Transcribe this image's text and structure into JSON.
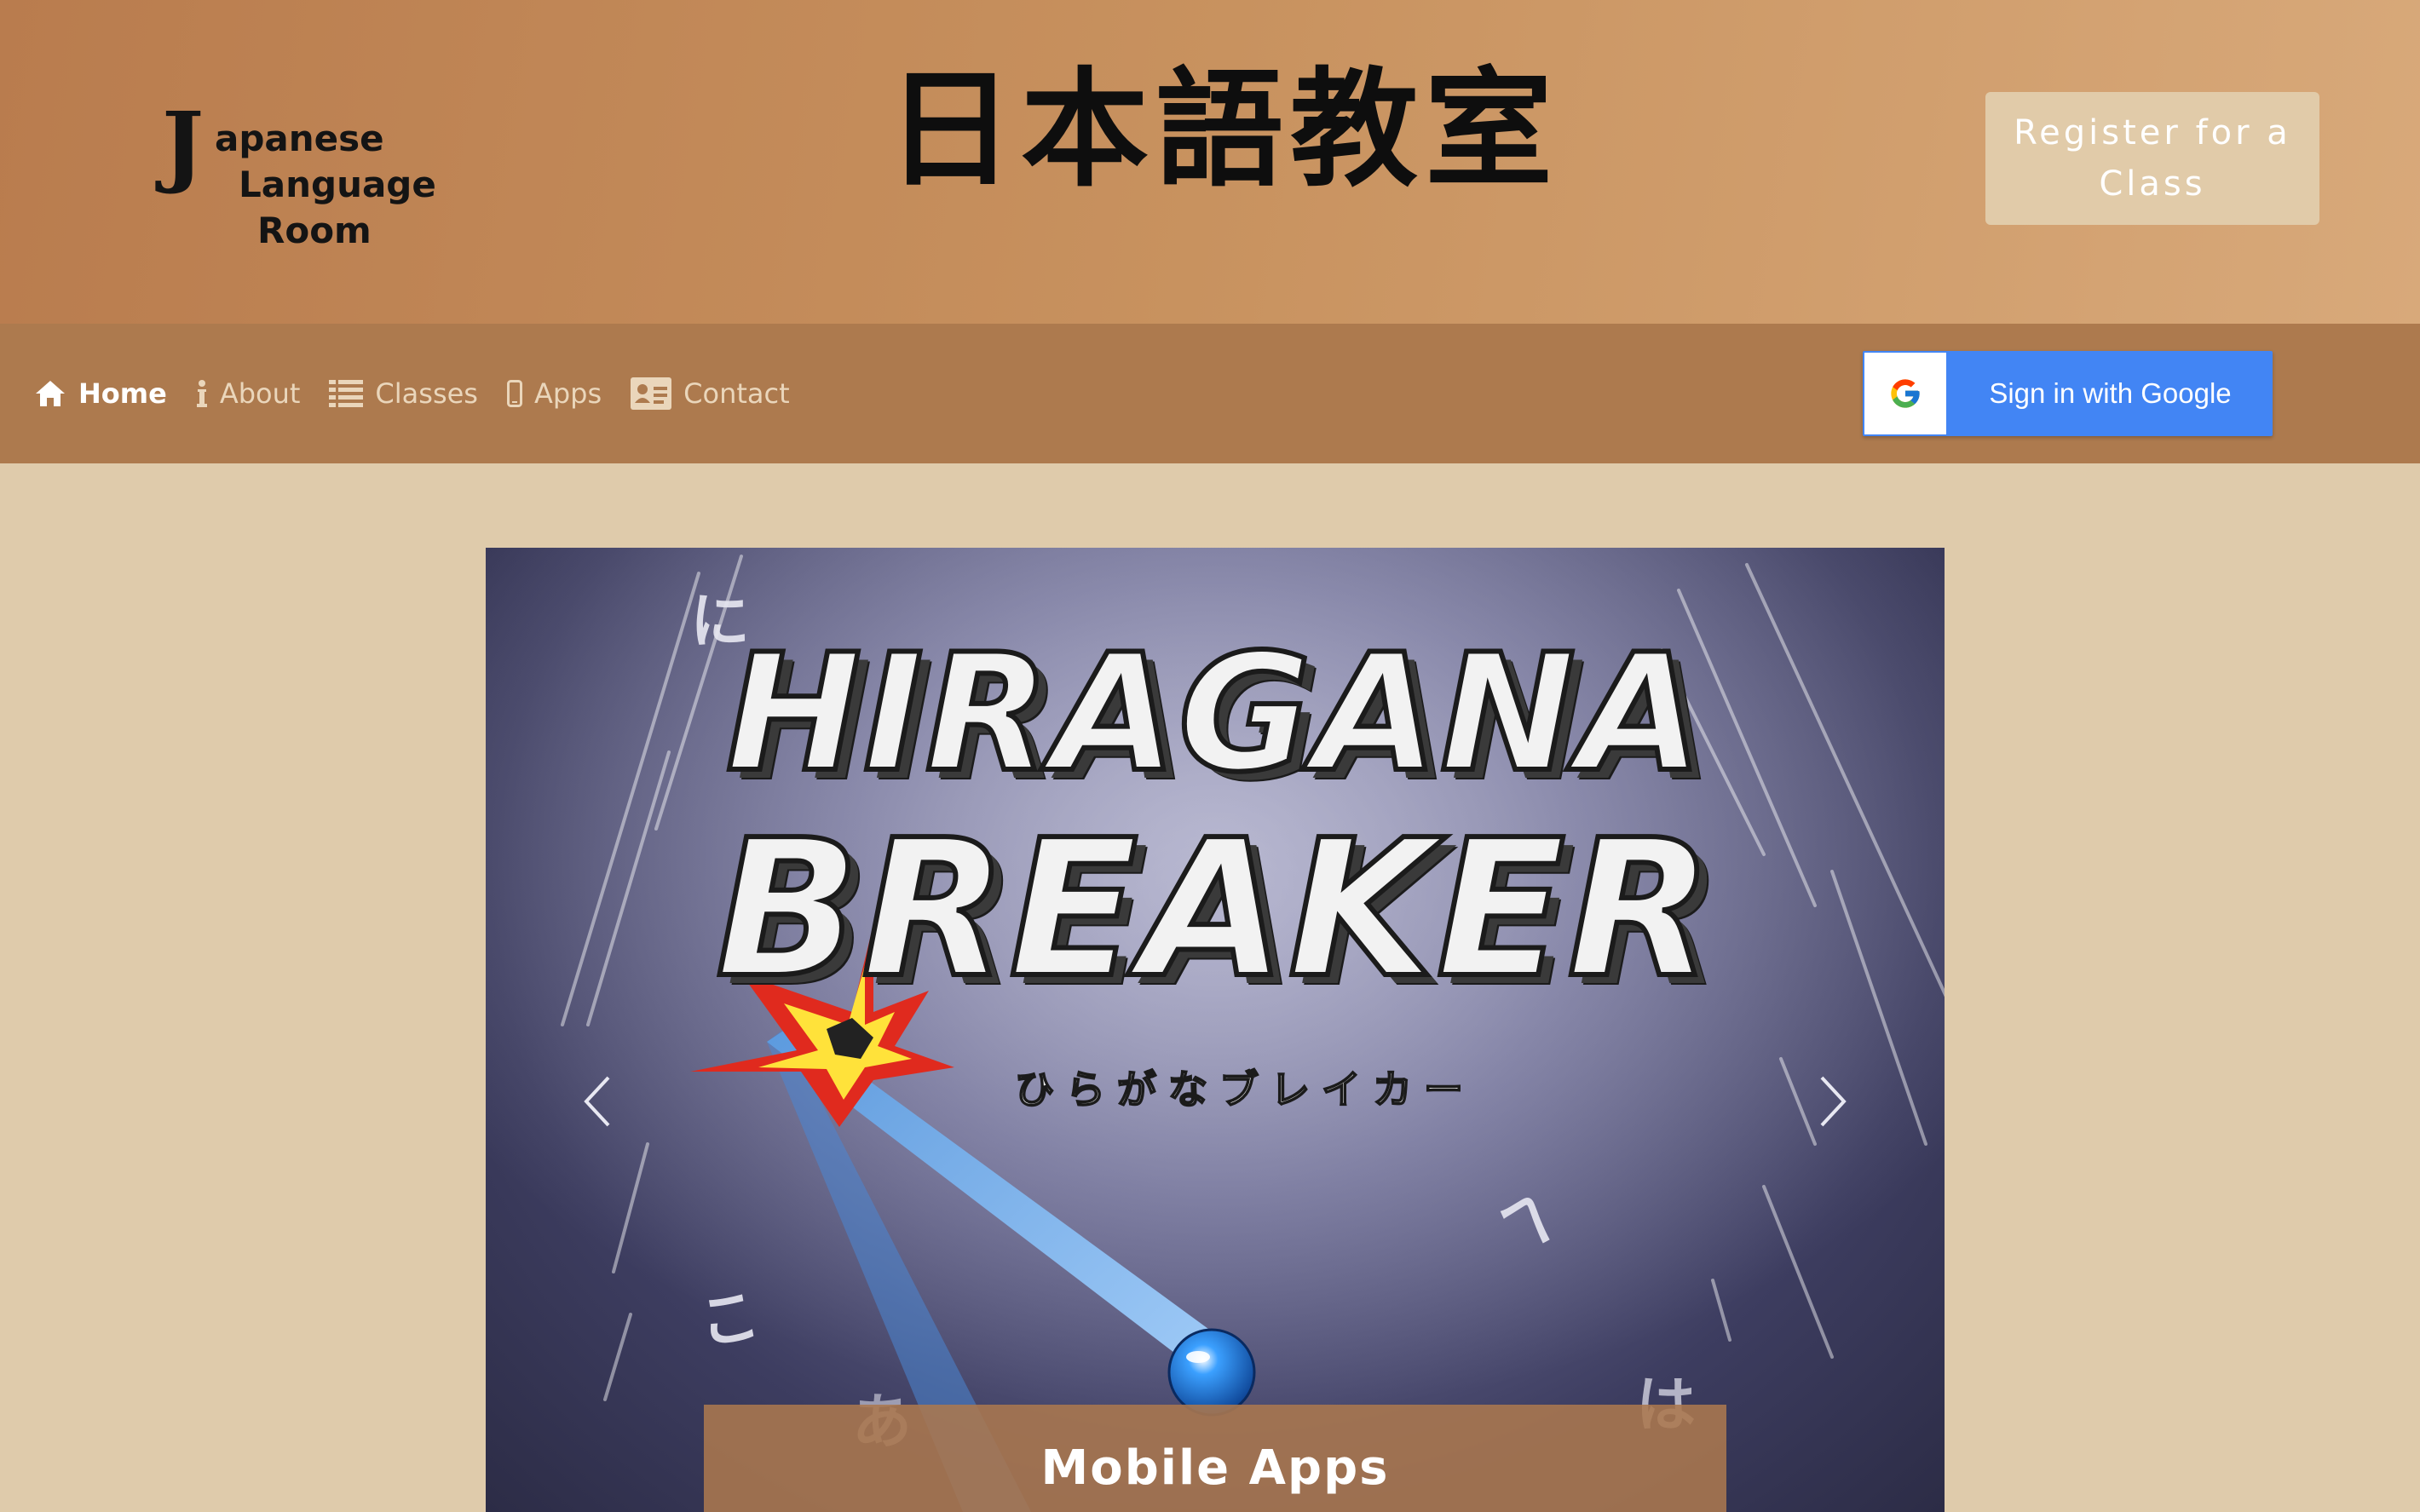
{
  "header": {
    "logo": {
      "initial": "J",
      "line1": "apanese",
      "line2": "Language",
      "line3": "Room"
    },
    "site_title": "日本語教室",
    "register_button": "Register for a Class"
  },
  "nav": {
    "items": [
      {
        "label": "Home",
        "icon": "home-icon",
        "active": true
      },
      {
        "label": "About",
        "icon": "info-icon",
        "active": false
      },
      {
        "label": "Classes",
        "icon": "list-icon",
        "active": false
      },
      {
        "label": "Apps",
        "icon": "mobile-icon",
        "active": false
      },
      {
        "label": "Contact",
        "icon": "contact-card-icon",
        "active": false
      }
    ],
    "signin": {
      "label": "Sign in with Google",
      "icon": "google-icon"
    }
  },
  "carousel": {
    "slide": {
      "title_line1": "HIRAGANA",
      "title_line2": "BREAKER",
      "subtitle": "ひらがなブレイカー",
      "floating_kana": [
        "に",
        "へ",
        "こ",
        "あ",
        "は"
      ],
      "caption": "Mobile Apps"
    },
    "prev_icon": "chevron-left-icon",
    "next_icon": "chevron-right-icon"
  },
  "colors": {
    "header_start": "#b97c4e",
    "header_end": "#d8a97a",
    "navbar": "#ad7a4e",
    "page_background": "#dfcbab",
    "register_button": "#e1cba9",
    "google_blue": "#4285f4",
    "caption_background": "#ab784e"
  }
}
